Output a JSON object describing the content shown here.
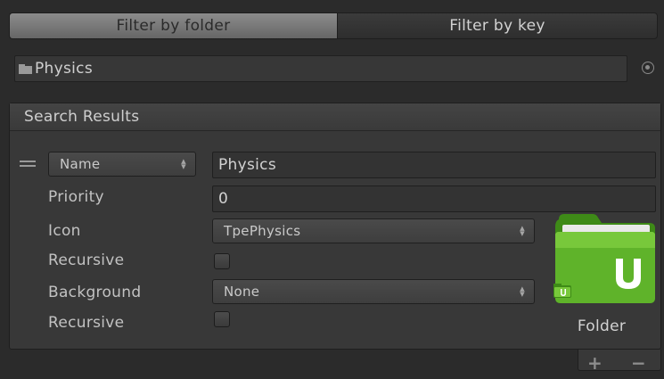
{
  "tabs": [
    {
      "label": "Filter by folder",
      "active": true
    },
    {
      "label": "Filter by key",
      "active": false
    }
  ],
  "folder_path": "Physics",
  "search_results": {
    "title": "Search Results",
    "rule": {
      "match_mode": "Name",
      "match_value": "Physics",
      "fields": {
        "priority_label": "Priority",
        "priority_value": "0",
        "icon_label": "Icon",
        "icon_value": "TpePhysics",
        "recursive_label": "Recursive",
        "icon_recursive": false,
        "background_label": "Background",
        "background_value": "None",
        "background_recursive_label": "Recursive",
        "background_recursive": false
      },
      "preview_caption": "Folder"
    }
  },
  "footer": {
    "add": "+",
    "remove": "−"
  },
  "colors": {
    "folder_green": "#5fb32a",
    "folder_green_dark": "#3e8a17",
    "background": "#2b2b2b"
  }
}
